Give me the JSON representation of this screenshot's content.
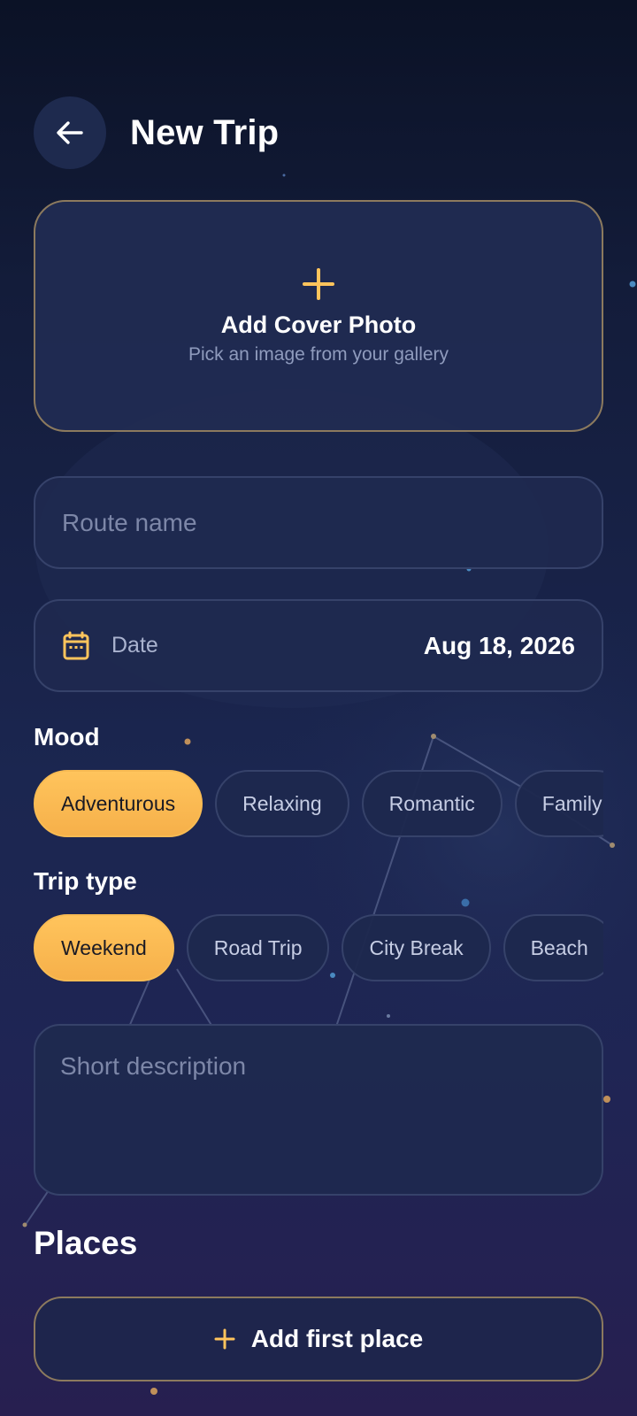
{
  "header": {
    "title": "New Trip",
    "back_icon": "arrow-left-icon"
  },
  "cover": {
    "title": "Add Cover Photo",
    "subtitle": "Pick an image from your gallery",
    "icon": "plus-icon"
  },
  "route": {
    "value": "",
    "placeholder": "Route name"
  },
  "date": {
    "label": "Date",
    "value": "Aug 18, 2026",
    "icon": "calendar-icon"
  },
  "mood": {
    "label": "Mood",
    "chips": [
      {
        "label": "Adventurous",
        "selected": true
      },
      {
        "label": "Relaxing",
        "selected": false
      },
      {
        "label": "Romantic",
        "selected": false
      },
      {
        "label": "Family",
        "selected": false
      }
    ]
  },
  "trip_type": {
    "label": "Trip type",
    "chips": [
      {
        "label": "Weekend",
        "selected": true
      },
      {
        "label": "Road Trip",
        "selected": false
      },
      {
        "label": "City Break",
        "selected": false
      },
      {
        "label": "Beach",
        "selected": false
      }
    ]
  },
  "description": {
    "value": "",
    "placeholder": "Short description"
  },
  "places": {
    "title": "Places",
    "add_label": "Add first place",
    "add_icon": "plus-icon"
  },
  "colors": {
    "accent": "#FFC45C",
    "background": "#131C3A",
    "card": "#1F294F",
    "border_gold": "#8C7A5E"
  }
}
